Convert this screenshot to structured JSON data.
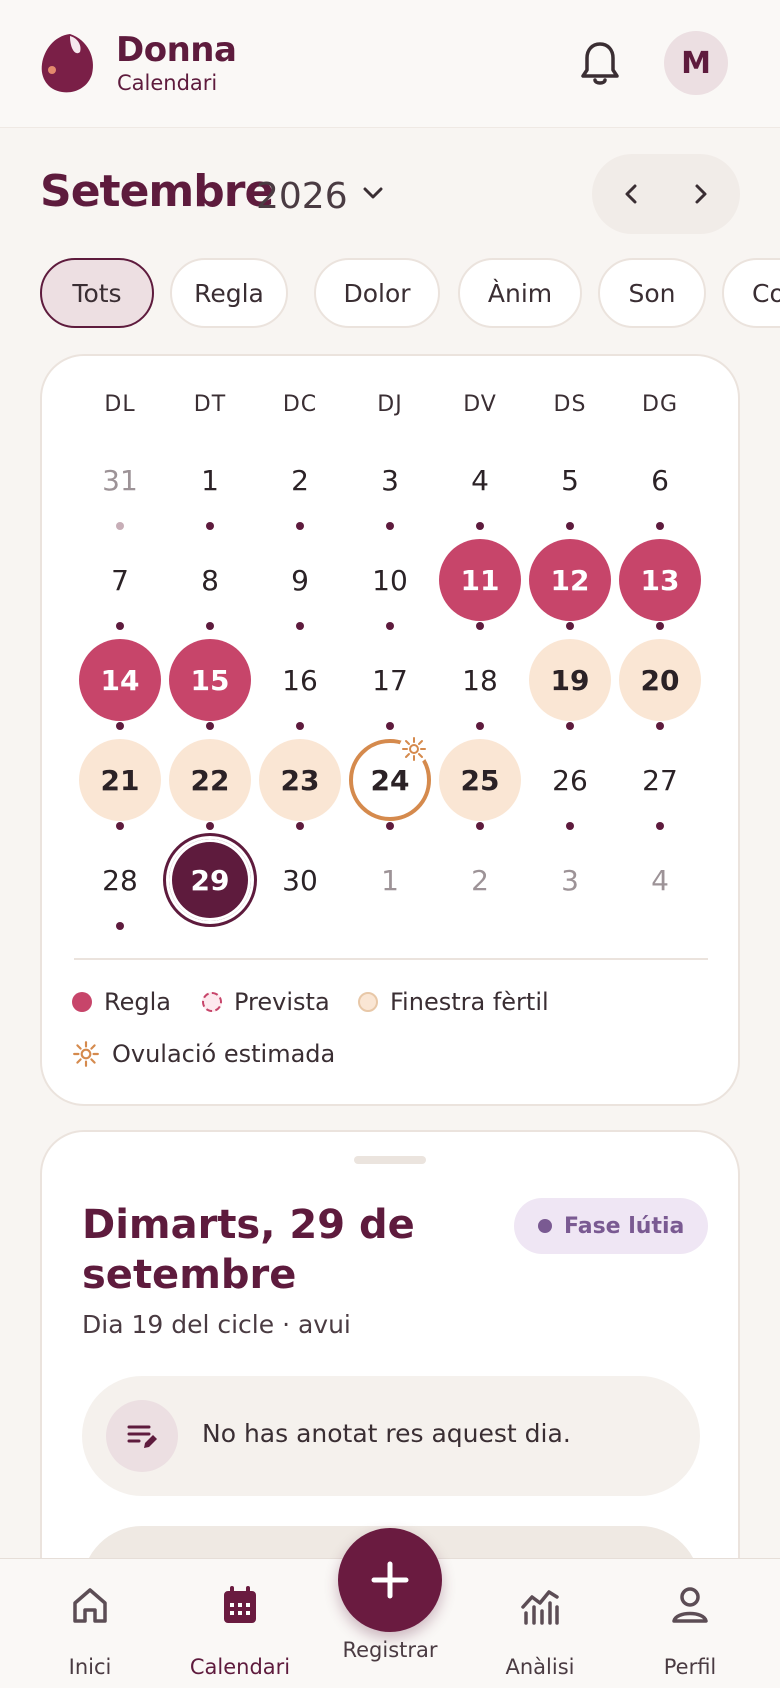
{
  "brand": {
    "name": "Donna",
    "subtitle": "Calendari"
  },
  "user": {
    "initial": "M"
  },
  "month": {
    "name": "Setembre",
    "year": "2026"
  },
  "filters": [
    "Tots",
    "Regla",
    "Dolor",
    "Ànim",
    "Son",
    "Co"
  ],
  "weekdays": [
    "DL",
    "DT",
    "DC",
    "DJ",
    "DV",
    "DS",
    "DG"
  ],
  "days": [
    [
      "31",
      "1",
      "2",
      "3",
      "4",
      "5",
      "6"
    ],
    [
      "7",
      "8",
      "9",
      "10",
      "11",
      "12",
      "13"
    ],
    [
      "14",
      "15",
      "16",
      "17",
      "18",
      "19",
      "20"
    ],
    [
      "21",
      "22",
      "23",
      "24",
      "25",
      "26",
      "27"
    ],
    [
      "28",
      "29",
      "30",
      "1",
      "2",
      "3",
      "4"
    ]
  ],
  "legend": {
    "period": "Regla",
    "predicted": "Prevista",
    "fertile": "Finestra fèrtil",
    "ovulation": "Ovulació estimada"
  },
  "detail": {
    "title": "Dimarts, 29 de setembre",
    "phase": "Fase lútia",
    "subtitle": "Dia 19 del cicle · avui",
    "empty_note": "No has anotat res aquest dia."
  },
  "tabs": {
    "home": "Inici",
    "calendar": "Calendari",
    "log": "Registrar",
    "analysis": "Anàlisi",
    "profile": "Perfil"
  },
  "colors": {
    "brand": "#5e1b3d",
    "period": "#c7456a",
    "fertile": "#fae6d4",
    "ovulation": "#d58a4d",
    "phase": "#7a5a92"
  }
}
